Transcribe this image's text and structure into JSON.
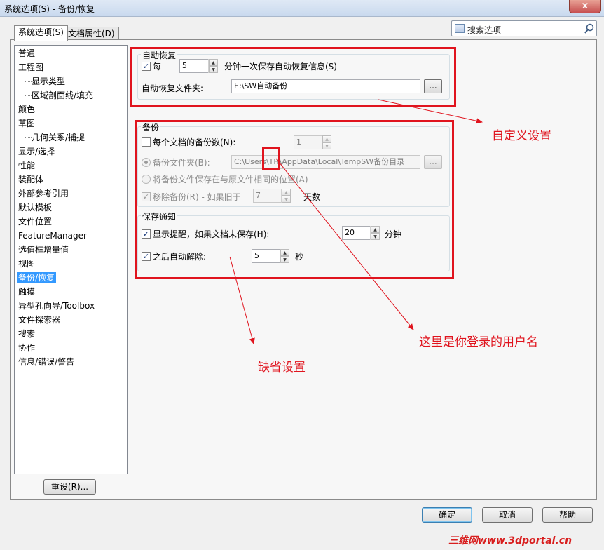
{
  "window": {
    "title": "系统选项(S) - 备份/恢复",
    "close_label": "x"
  },
  "tabs": [
    {
      "label": "系统选项(S)",
      "active": true
    },
    {
      "label": "文档属性(D)",
      "active": false
    }
  ],
  "search": {
    "placeholder": "搜索选项"
  },
  "tree": {
    "items": [
      {
        "label": "普通",
        "level": 0
      },
      {
        "label": "工程图",
        "level": 0
      },
      {
        "label": "显示类型",
        "level": 1
      },
      {
        "label": "区域剖面线/填充",
        "level": 1
      },
      {
        "label": "颜色",
        "level": 0
      },
      {
        "label": "草图",
        "level": 0
      },
      {
        "label": "几何关系/捕捉",
        "level": 1
      },
      {
        "label": "显示/选择",
        "level": 0
      },
      {
        "label": "性能",
        "level": 0
      },
      {
        "label": "装配体",
        "level": 0
      },
      {
        "label": "外部参考引用",
        "level": 0
      },
      {
        "label": "默认模板",
        "level": 0
      },
      {
        "label": "文件位置",
        "level": 0
      },
      {
        "label": "FeatureManager",
        "level": 0
      },
      {
        "label": "选值框增量值",
        "level": 0
      },
      {
        "label": "视图",
        "level": 0
      },
      {
        "label": "备份/恢复",
        "level": 0,
        "selected": true
      },
      {
        "label": "触摸",
        "level": 0
      },
      {
        "label": "异型孔向导/Toolbox",
        "level": 0
      },
      {
        "label": "文件探索器",
        "level": 0
      },
      {
        "label": "搜索",
        "level": 0
      },
      {
        "label": "协作",
        "level": 0
      },
      {
        "label": "信息/错误/警告",
        "level": 0
      }
    ]
  },
  "autorecover": {
    "group_title": "自动恢复",
    "every_label": "每",
    "every_checked": true,
    "interval_value": "5",
    "interval_suffix": "分钟一次保存自动恢复信息(S)",
    "folder_label": "自动恢复文件夹:",
    "folder_value": "E:\\SW自动备份",
    "browse_label": "..."
  },
  "backup": {
    "group_title": "备份",
    "copies_label": "每个文档的备份数(N):",
    "copies_checked": false,
    "copies_value": "1",
    "folder_radio_label": "备份文件夹(B):",
    "folder_value": "C:\\Users\\TH\\AppData\\Local\\TempSW备份目录",
    "browse_label": "...",
    "same_location_label": "将备份文件保存在与原文件相同的位置(A)",
    "remove_label": "移除备份(R) - 如果旧于",
    "remove_checked": true,
    "remove_value": "7",
    "remove_suffix": "天数"
  },
  "save_notify": {
    "group_title": "保存通知",
    "reminder_label": "显示提醒，如果文档未保存(H):",
    "reminder_checked": true,
    "reminder_value": "20",
    "reminder_suffix": "分钟",
    "dismiss_label": "之后自动解除:",
    "dismiss_checked": true,
    "dismiss_value": "5",
    "dismiss_suffix": "秒"
  },
  "buttons": {
    "reset": "重设(R)...",
    "ok": "确定",
    "cancel": "取消",
    "help": "帮助"
  },
  "annotations": {
    "custom": "自定义设置",
    "username": "这里是你登录的用户名",
    "default": "缺省设置",
    "color": "#e0141e"
  },
  "watermark": "三维网www.3dportal.cn"
}
